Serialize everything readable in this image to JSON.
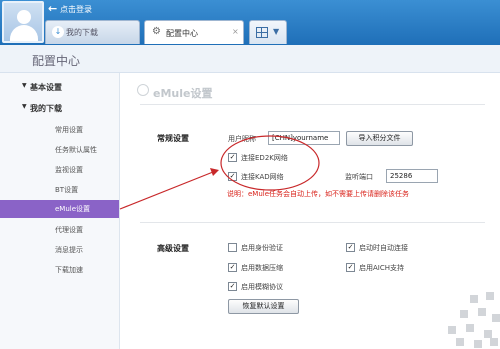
{
  "topbar": {
    "login_label": "点击登录",
    "tabs": [
      {
        "label": "我的下载"
      },
      {
        "label": "配置中心",
        "close": "×"
      }
    ]
  },
  "subheader": {
    "title": "配置中心"
  },
  "sidebar": {
    "categories": [
      {
        "label": "基本设置"
      },
      {
        "label": "我的下载"
      }
    ],
    "items": [
      {
        "label": "常用设置"
      },
      {
        "label": "任务默认属性"
      },
      {
        "label": "监视设置"
      },
      {
        "label": "BT设置"
      },
      {
        "label": "eMule设置",
        "active": true
      },
      {
        "label": "代理设置"
      },
      {
        "label": "消息提示"
      },
      {
        "label": "下载加速"
      }
    ]
  },
  "main": {
    "title": "eMule设置",
    "general": {
      "section_label": "常规设置",
      "nickname_label": "用户昵称",
      "nickname_value": "[CHN]yourname",
      "import_button": "导入积分文件",
      "ed2k_label": "连接ED2K网络",
      "ed2k_checked": true,
      "kad_label": "连接KAD网络",
      "kad_checked": true,
      "port_label": "监听端口",
      "port_value": "25286",
      "note": "说明：eMule任务会自动上传，如不需要上传请删除该任务"
    },
    "advanced": {
      "section_label": "高级设置",
      "options": [
        {
          "label": "启用身份验证",
          "checked": false
        },
        {
          "label": "启动时自动连接",
          "checked": true
        },
        {
          "label": "启用数据压缩",
          "checked": true
        },
        {
          "label": "启用AICH支持",
          "checked": true
        },
        {
          "label": "启用模糊协议",
          "checked": true
        }
      ],
      "restore_button": "恢复默认设置"
    }
  },
  "colors": {
    "topbar": "#2a7dc4",
    "active_sidebar": "#8a63c7",
    "annotation": "#c8282a"
  }
}
